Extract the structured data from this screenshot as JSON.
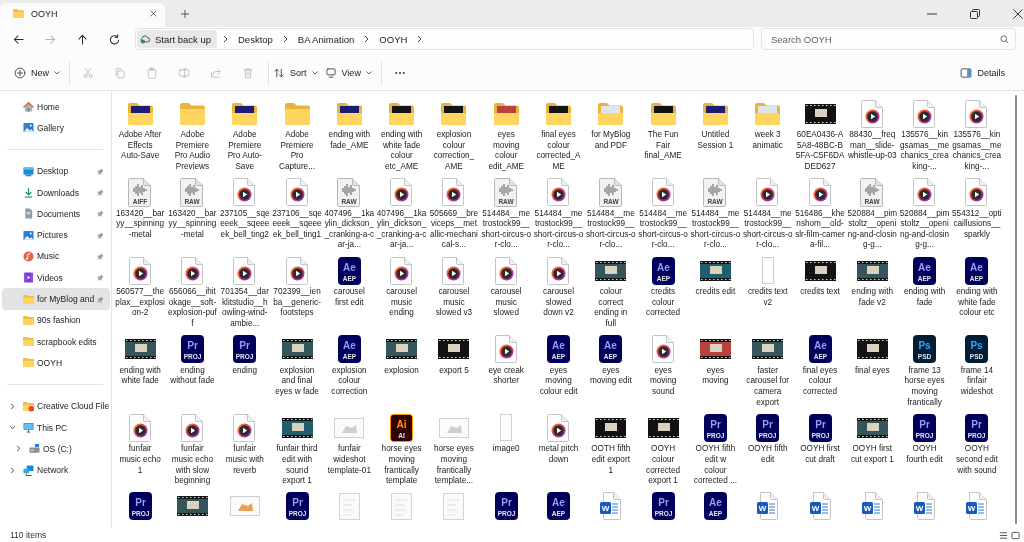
{
  "window": {
    "tabs": [
      {
        "title": "OOYH",
        "selected": true
      }
    ]
  },
  "address_bar": {
    "nav": [
      {
        "kind": "back",
        "disabled": false
      },
      {
        "kind": "forward",
        "disabled": true
      },
      {
        "kind": "up",
        "disabled": false
      },
      {
        "kind": "refresh",
        "disabled": false
      }
    ],
    "breadcrumbs": [
      {
        "kind": "backup",
        "label": "Start back up"
      },
      {
        "kind": "folder",
        "label": "Desktop"
      },
      {
        "kind": "folder",
        "label": "BA Animation"
      },
      {
        "kind": "folder",
        "label": "OOYH"
      }
    ]
  },
  "search": {
    "placeholder": "Search OOYH"
  },
  "toolbar": {
    "items": [
      {
        "kind": "new",
        "label": "New",
        "disabled": false
      },
      {
        "kind": "cut",
        "disabled": true
      },
      {
        "kind": "copy",
        "disabled": true
      },
      {
        "kind": "paste",
        "disabled": true
      },
      {
        "kind": "rename",
        "disabled": true
      },
      {
        "kind": "share",
        "disabled": true
      },
      {
        "kind": "delete",
        "disabled": true
      },
      {
        "kind": "sort",
        "label": "Sort",
        "disabled": false
      },
      {
        "kind": "view",
        "label": "View",
        "disabled": false
      },
      {
        "kind": "more",
        "disabled": false
      }
    ],
    "details": {
      "label": "Details"
    }
  },
  "sidebar": {
    "sections": [
      [
        {
          "kind": "home",
          "label": "Home",
          "selected": false
        },
        {
          "kind": "gallery",
          "label": "Gallery",
          "selected": false
        }
      ],
      [
        {
          "kind": "desktop",
          "label": "Desktop",
          "pinned": true,
          "selected": false
        },
        {
          "kind": "downloads",
          "label": "Downloads",
          "pinned": true,
          "selected": false
        },
        {
          "kind": "documents",
          "label": "Documents",
          "pinned": true,
          "selected": false
        },
        {
          "kind": "pictures",
          "label": "Pictures",
          "pinned": true,
          "selected": false
        },
        {
          "kind": "music",
          "label": "Music",
          "pinned": true,
          "selected": false
        },
        {
          "kind": "videos",
          "label": "Videos",
          "pinned": true,
          "selected": false
        },
        {
          "kind": "folder",
          "label": "for MyBlog and",
          "pinned": true,
          "selected": true
        },
        {
          "kind": "folder",
          "label": "90s fashion",
          "pinned": false,
          "selected": false
        },
        {
          "kind": "folder",
          "label": "scrapbook edits",
          "pinned": false,
          "selected": false
        },
        {
          "kind": "folder",
          "label": "OOYH",
          "pinned": false,
          "selected": false
        }
      ],
      [
        {
          "kind": "cloud",
          "label": "Creative Cloud File",
          "expanded": false,
          "selected": false
        },
        {
          "kind": "pc",
          "label": "This PC",
          "expanded": true,
          "selected": false,
          "children": [
            {
              "kind": "drive",
              "label": "OS (C:)",
              "expanded": false,
              "selected": false
            }
          ]
        },
        {
          "kind": "network",
          "label": "Network",
          "expanded": false,
          "selected": false
        }
      ]
    ]
  },
  "files": {
    "items": [
      {
        "name": "Adobe After Effects Auto-Save",
        "kind": "folder",
        "color": "#1c1c74",
        "selected": false
      },
      {
        "name": "Adobe Premiere Pro Audio Previews",
        "kind": "folder",
        "selected": false
      },
      {
        "name": "Adobe Premiere Pro Auto-Save",
        "kind": "folder",
        "color": "#1c1c74",
        "selected": false
      },
      {
        "name": "Adobe Premiere Pro Capture...",
        "kind": "folder",
        "selected": false
      },
      {
        "name": "ending with fade_AME",
        "kind": "folder",
        "color": "#1c1c74",
        "selected": false
      },
      {
        "name": "ending with white fade colour etc_AME",
        "kind": "folder",
        "color": "#141414",
        "selected": false
      },
      {
        "name": "explosion colour correction_AME",
        "kind": "folder",
        "color": "#141414",
        "selected": false
      },
      {
        "name": "eyes moving colour edit_AME",
        "kind": "folder",
        "color": "#b8433c",
        "selected": false
      },
      {
        "name": "final eyes colour corrected_AME",
        "kind": "folder",
        "color": "#141414",
        "selected": false
      },
      {
        "name": "for MyBlog and PDF",
        "kind": "folder",
        "color": "#dfe6ea",
        "selected": false
      },
      {
        "name": "The Fun Fair final_AME",
        "kind": "folder",
        "color": "#111111",
        "selected": false
      },
      {
        "name": "Untitled Session 1",
        "kind": "folder",
        "color": "#1c1c74",
        "selected": false
      },
      {
        "name": "week 3 animatic",
        "kind": "folder",
        "color": "#dfe6ea",
        "selected": false
      },
      {
        "name": "60EA0436-A5A8-48BC-B5FA-C5F6DADED627",
        "kind": "video",
        "color": "#111111",
        "selected": false
      },
      {
        "name": "88430__freqman__slide-whistle-up-03",
        "kind": "media",
        "selected": false
      },
      {
        "name": "135576__kingsamas__mechanics_creaking-...",
        "kind": "media",
        "selected": false
      },
      {
        "name": "135576__kingsamas__mechanics_creaking-...",
        "kind": "media",
        "selected": false
      },
      {
        "name": "163420__baryy__spinning-metal",
        "kind": "audio",
        "tag": "AIFF",
        "selected": false
      },
      {
        "name": "163420__baryy__spinning-metal",
        "kind": "audio",
        "tag": "RAW",
        "selected": false
      },
      {
        "name": "237105__sqeeeek__sqeeeek_bell_ting2",
        "kind": "media",
        "selected": false
      },
      {
        "name": "237106__sqeeeek__sqeeeek_bell_ting1",
        "kind": "media",
        "selected": false
      },
      {
        "name": "407496__1kaylin_dickson__cranking-a-car-ja...",
        "kind": "audio",
        "tag": "RAW",
        "selected": false
      },
      {
        "name": "407496__1kaylin_dickson__cranking-a-car-ja...",
        "kind": "media",
        "selected": false
      },
      {
        "name": "505669__breviceps__metallic-mechanical-s...",
        "kind": "media",
        "selected": false
      },
      {
        "name": "514484__metrostock99__short-circus-or-clo...",
        "kind": "audio",
        "tag": "RAW",
        "selected": false
      },
      {
        "name": "514484__metrostock99__short-circus-or-clo...",
        "kind": "media",
        "selected": false
      },
      {
        "name": "514484__metrostock99__short-circus-or-clo...",
        "kind": "audio",
        "tag": "RAW",
        "selected": false
      },
      {
        "name": "514484__metrostock99__short-circus-or-clo...",
        "kind": "media",
        "selected": false
      },
      {
        "name": "514484__metrostock99__short-circus-or-clo...",
        "kind": "audio",
        "tag": "RAW",
        "selected": false
      },
      {
        "name": "514484__metrostock99__short-circus-or-clo...",
        "kind": "media",
        "selected": false
      },
      {
        "name": "516486__khenshom__old-slr-film-camera-fil...",
        "kind": "media",
        "selected": false
      },
      {
        "name": "520884__pimstoltz__opening-and-closing-g...",
        "kind": "audio",
        "tag": "RAW",
        "selected": false
      },
      {
        "name": "520884__pimstoltz__opening-and-closing-g...",
        "kind": "media",
        "selected": false
      },
      {
        "name": "554312__opticaillusions__sparkly",
        "kind": "media",
        "selected": false
      },
      {
        "name": "560577__theplax__explosion-2",
        "kind": "media",
        "selected": false
      },
      {
        "name": "656066__ihitokage__soft-explosion-puff",
        "kind": "media",
        "selected": false
      },
      {
        "name": "701354__darklitstudio__howling-wind-ambie...",
        "kind": "media",
        "selected": false
      },
      {
        "name": "702399__ienba__generic-footsteps",
        "kind": "media",
        "selected": false
      },
      {
        "name": "carousel first edit",
        "kind": "ae",
        "logo": "Ae",
        "tag": "AEP",
        "selected": false
      },
      {
        "name": "carousel music ending",
        "kind": "media",
        "selected": false
      },
      {
        "name": "carousel music slowed v3",
        "kind": "media",
        "selected": false
      },
      {
        "name": "carousel music slowed",
        "kind": "media",
        "selected": false
      },
      {
        "name": "carousel slowed down v2",
        "kind": "media",
        "selected": false
      },
      {
        "name": "colour correct ending in full",
        "kind": "video",
        "color": "#34555a",
        "selected": false
      },
      {
        "name": "credits colour corrected",
        "kind": "ae",
        "logo": "Ae",
        "tag": "AEP",
        "selected": false
      },
      {
        "name": "credits edit",
        "kind": "video",
        "color": "#1f5f6a",
        "selected": false
      },
      {
        "name": "credits text v2",
        "kind": "page",
        "selected": false
      },
      {
        "name": "credits text",
        "kind": "video",
        "color": "#141414",
        "selected": false
      },
      {
        "name": "ending with fade v2",
        "kind": "video",
        "color": "#34555a",
        "selected": false
      },
      {
        "name": "ending with fade",
        "kind": "ae",
        "logo": "Ae",
        "tag": "AEP",
        "selected": false
      },
      {
        "name": "ending with white fade colour etc",
        "kind": "ae",
        "logo": "Ae",
        "tag": "AEP",
        "selected": false
      },
      {
        "name": "ending with white fade",
        "kind": "video",
        "color": "#34555a",
        "selected": false
      },
      {
        "name": "ending without fade",
        "kind": "pr",
        "logo": "Pr",
        "tag": "PROJ",
        "selected": false
      },
      {
        "name": "ending",
        "kind": "pr",
        "logo": "Pr",
        "tag": "PROJ",
        "selected": false
      },
      {
        "name": "explosion and final eyes w fade",
        "kind": "video",
        "color": "#34555a",
        "selected": false
      },
      {
        "name": "explosion colour correction",
        "kind": "ae",
        "logo": "Ae",
        "tag": "AEP",
        "selected": false
      },
      {
        "name": "explosion",
        "kind": "video",
        "color": "#34555a",
        "selected": false
      },
      {
        "name": "export 5",
        "kind": "video",
        "color": "#111111",
        "selected": false
      },
      {
        "name": "eye creak shorter",
        "kind": "media",
        "selected": false
      },
      {
        "name": "eyes moving colour edit",
        "kind": "ae",
        "logo": "Ae",
        "tag": "AEP",
        "selected": false
      },
      {
        "name": "eyes moving edit",
        "kind": "ae",
        "logo": "Ae",
        "tag": "AEP",
        "selected": false
      },
      {
        "name": "eyes moving sound",
        "kind": "media",
        "selected": false
      },
      {
        "name": "eyes moving",
        "kind": "video",
        "color": "#b8433c",
        "selected": false
      },
      {
        "name": "faster carousel for camera export",
        "kind": "video",
        "color": "#34555a",
        "selected": false
      },
      {
        "name": "final eyes colour corrected",
        "kind": "ae",
        "logo": "Ae",
        "tag": "AEP",
        "selected": false
      },
      {
        "name": "final eyes",
        "kind": "video",
        "color": "#141414",
        "selected": false
      },
      {
        "name": "frame 13 horse eyes moving frantically",
        "kind": "ps",
        "logo": "Ps",
        "tag": "PSD",
        "selected": false
      },
      {
        "name": "frame 14 finfair wideshot",
        "kind": "ps",
        "logo": "Ps",
        "tag": "PSD",
        "selected": false
      },
      {
        "name": "funfair music echo 1",
        "kind": "media",
        "selected": false
      },
      {
        "name": "funfair music echo with slow beginning",
        "kind": "media",
        "selected": false
      },
      {
        "name": "funfair music with reverb",
        "kind": "media",
        "selected": false
      },
      {
        "name": "funfair third edit with sound export 1",
        "kind": "video",
        "color": "#1f5f6a",
        "selected": false
      },
      {
        "name": "funfair wideshot template-01",
        "kind": "image",
        "color": "#c9cfd4",
        "selected": false
      },
      {
        "name": "horse eyes moving frantically template",
        "kind": "ai",
        "logo": "Ai",
        "tag": "AI",
        "selected": false
      },
      {
        "name": "horse eyes moving frantically template...",
        "kind": "image",
        "color": "#c9cfd4",
        "selected": false
      },
      {
        "name": "image0",
        "kind": "page",
        "selected": false
      },
      {
        "name": "metal pitch down",
        "kind": "media",
        "selected": false
      },
      {
        "name": "OOTH fifth edit export 1",
        "kind": "video",
        "color": "#111111",
        "selected": false
      },
      {
        "name": "OOYH colour corrected export 1",
        "kind": "video",
        "color": "#111111",
        "selected": false
      },
      {
        "name": "OOYH fifth edit w colour corrected ...",
        "kind": "pr",
        "logo": "Pr",
        "tag": "PROJ",
        "selected": false
      },
      {
        "name": "OOYH fifth edit",
        "kind": "pr",
        "logo": "Pr",
        "tag": "PROJ",
        "selected": false
      },
      {
        "name": "OOYH first cut draft",
        "kind": "pr",
        "logo": "Pr",
        "tag": "PROJ",
        "selected": false
      },
      {
        "name": "OOYH first cut export 1",
        "kind": "video",
        "color": "#34555a",
        "selected": false
      },
      {
        "name": "OOYH fourth edit",
        "kind": "pr",
        "logo": "Pr",
        "tag": "PROJ",
        "selected": false
      },
      {
        "name": "OOYH second edit with sound",
        "kind": "pr",
        "logo": "Pr",
        "tag": "PROJ",
        "selected": false
      },
      {
        "kind": "pr",
        "logo": "Pr",
        "tag": "PROJ",
        "selected": false
      },
      {
        "kind": "video",
        "color": "#34555a",
        "selected": false
      },
      {
        "kind": "image",
        "color": "#e3a15a",
        "selected": false
      },
      {
        "kind": "pr",
        "logo": "Pr",
        "tag": "PROJ",
        "selected": false
      },
      {
        "kind": "sketch",
        "selected": false
      },
      {
        "kind": "sketch",
        "selected": false
      },
      {
        "kind": "sketch",
        "selected": false
      },
      {
        "kind": "pr",
        "logo": "Pr",
        "tag": "PROJ",
        "selected": false
      },
      {
        "kind": "ae",
        "logo": "Ae",
        "tag": "AEP",
        "selected": false
      },
      {
        "kind": "word",
        "logo": "W",
        "selected": false
      },
      {
        "kind": "pr",
        "logo": "Pr",
        "tag": "PROJ",
        "selected": false
      },
      {
        "kind": "ae",
        "logo": "Ae",
        "tag": "AEP",
        "selected": false
      },
      {
        "kind": "word",
        "logo": "W",
        "selected": false
      },
      {
        "kind": "word",
        "logo": "W",
        "selected": false
      },
      {
        "kind": "word",
        "logo": "W",
        "selected": false
      },
      {
        "kind": "word",
        "logo": "W",
        "selected": false
      },
      {
        "kind": "word",
        "logo": "W",
        "selected": false
      }
    ]
  },
  "status_bar": {
    "count": "110 items"
  }
}
